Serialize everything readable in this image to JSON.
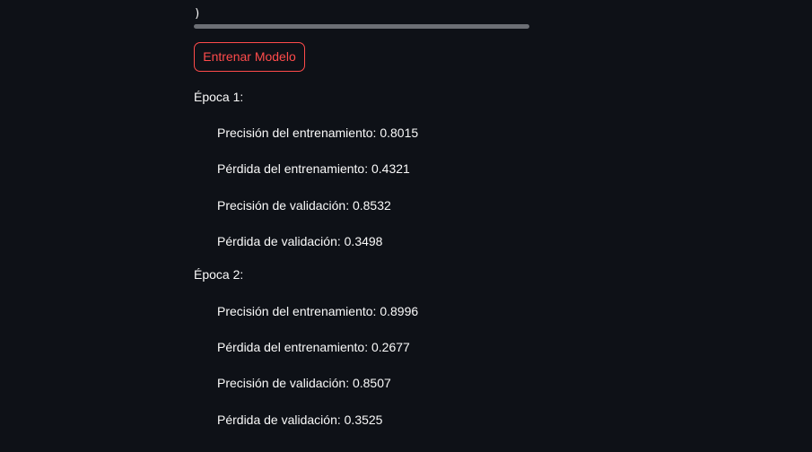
{
  "code_tail": ")",
  "train_button_label": "Entrenar Modelo",
  "epochs": [
    {
      "title": "Época 1:",
      "metrics": [
        "Precisión del entrenamiento: 0.8015",
        "Pérdida del entrenamiento: 0.4321",
        "Precisión de validación: 0.8532",
        "Pérdida de validación: 0.3498"
      ]
    },
    {
      "title": "Época 2:",
      "metrics": [
        "Precisión del entrenamiento: 0.8996",
        "Pérdida del entrenamiento: 0.2677",
        "Precisión de validación: 0.8507",
        "Pérdida de validación: 0.3525"
      ]
    }
  ],
  "colors": {
    "background": "#0e1117",
    "text": "#fafafa",
    "accent": "#ff4b4b",
    "scrollbar": "#6c6f75"
  }
}
